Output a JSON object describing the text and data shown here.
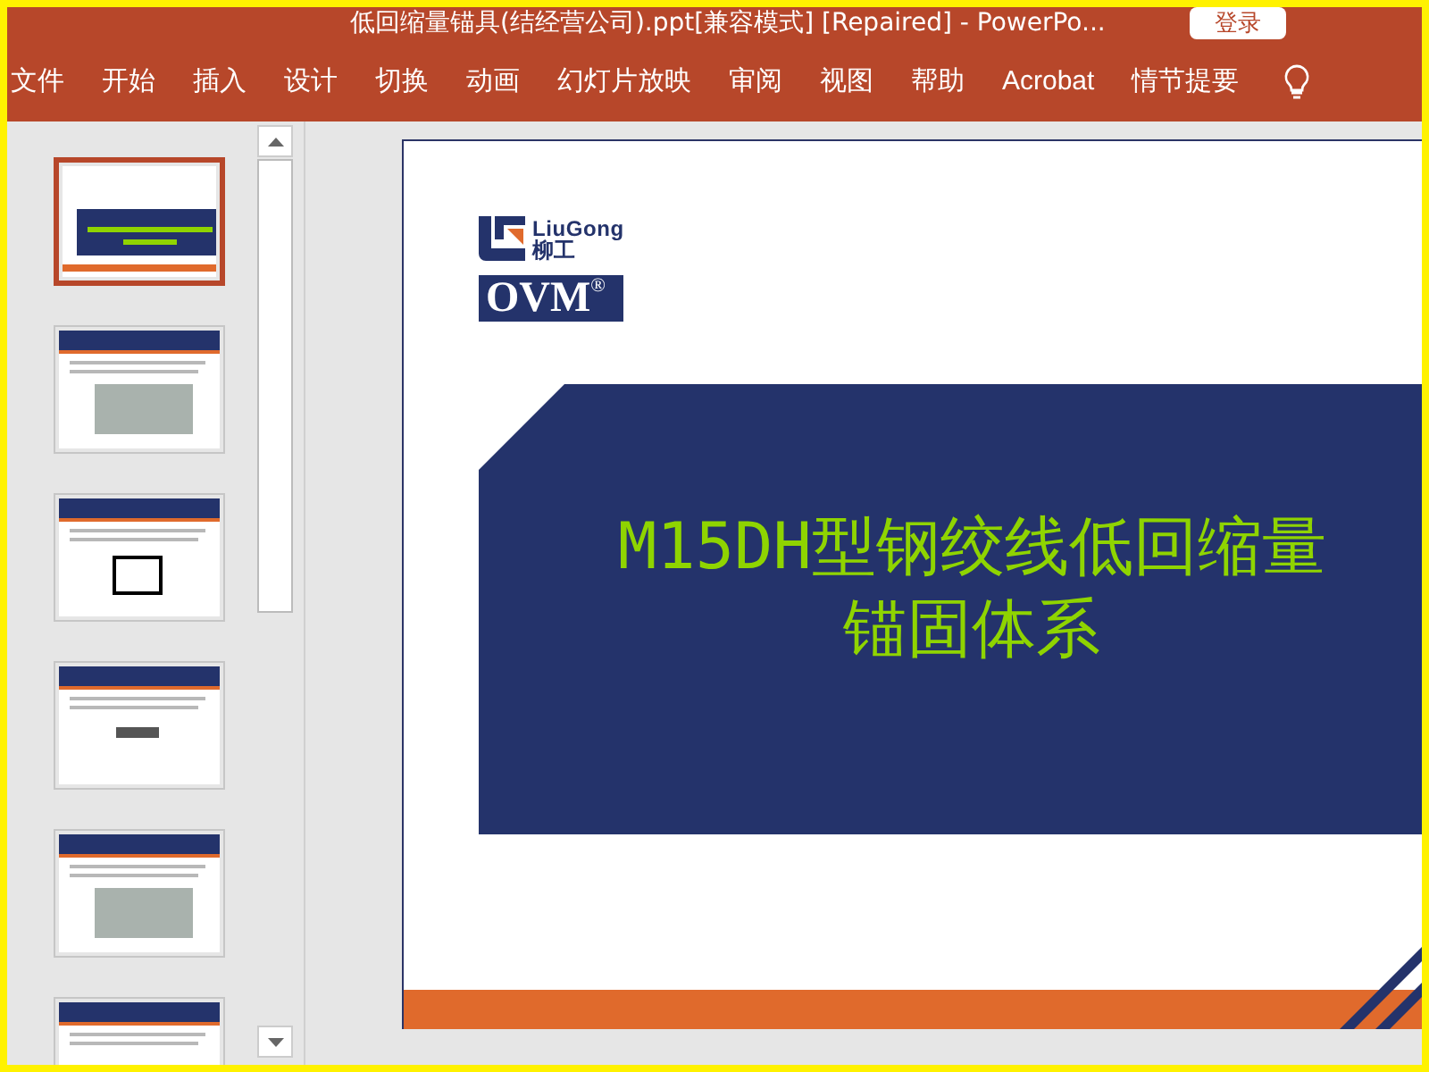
{
  "window": {
    "title": "低回缩量锚具(结经营公司).ppt[兼容模式] [Repaired]  -  PowerPo...",
    "login_button": "登录"
  },
  "ribbon_tabs": [
    {
      "label": "文件",
      "selected": false
    },
    {
      "label": "开始",
      "selected": false
    },
    {
      "label": "插入",
      "selected": false
    },
    {
      "label": "设计",
      "selected": false
    },
    {
      "label": "切换",
      "selected": false
    },
    {
      "label": "动画",
      "selected": false
    },
    {
      "label": "幻灯片放映",
      "selected": false
    },
    {
      "label": "审阅",
      "selected": false
    },
    {
      "label": "视图",
      "selected": false
    },
    {
      "label": "帮助",
      "selected": false
    },
    {
      "label": "Acrobat",
      "selected": false
    },
    {
      "label": "情节提要",
      "selected": false
    }
  ],
  "thumbnails": [
    {
      "kind": "title",
      "selected": true
    },
    {
      "kind": "photo",
      "selected": false
    },
    {
      "kind": "diagram",
      "selected": false
    },
    {
      "kind": "formula",
      "selected": false
    },
    {
      "kind": "photo",
      "selected": false
    },
    {
      "kind": "text",
      "selected": false
    }
  ],
  "slide": {
    "logo_name": "LiuGong",
    "logo_cn": "柳工",
    "brand": "OVM",
    "brand_mark": "®",
    "title_lines": [
      "M15DH型钢绞线低回缩量",
      "锚固体系"
    ]
  }
}
